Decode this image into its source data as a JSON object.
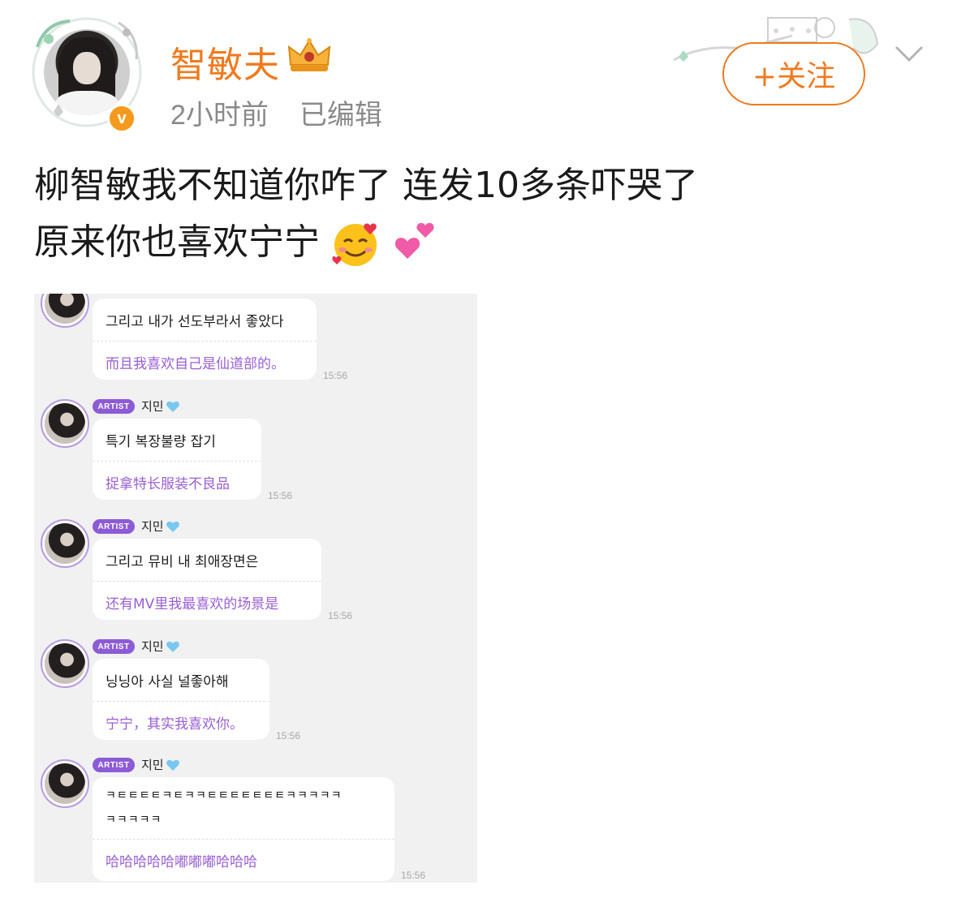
{
  "header": {
    "username": "智敏夫",
    "time_ago": "2小时前",
    "edited": "已编辑",
    "follow_label": "+关注",
    "verified_symbol": "v"
  },
  "post": {
    "line1": "柳智敏我不知道你咋了 连发10多条吓哭了",
    "line2": "原来你也喜欢宁宁"
  },
  "chat": {
    "messages": [
      {
        "sender": "",
        "badge": "",
        "ko": "그리고 내가 선도부라서 좋았다",
        "ko2": "",
        "zh": "而且我喜欢自己是仙道部的。",
        "time": "15:56"
      },
      {
        "sender": "지민",
        "badge": "ARTIST",
        "ko": "특기 복장불량 잡기",
        "ko2": "",
        "zh": "捉拿特长服装不良品",
        "time": "15:56"
      },
      {
        "sender": "지민",
        "badge": "ARTIST",
        "ko": "그리고 뮤비 내 최애장면은",
        "ko2": "",
        "zh": "还有MV里我最喜欢的场景是",
        "time": "15:56"
      },
      {
        "sender": "지민",
        "badge": "ARTIST",
        "ko": "닝닝아 사실 널좋아해",
        "ko2": "",
        "zh": "宁宁，其实我喜欢你。",
        "time": "15:56"
      },
      {
        "sender": "지민",
        "badge": "ARTIST",
        "ko": "ㅋㅌㅌㅌㅌㅋㅌㅋㅋㅌㅌㅌㅌㅌㅌㅌㅋㅋㅋㅋㅋ",
        "ko2": "ㅋㅋㅋㅋㅋ",
        "zh": "哈哈哈哈哈嘟嘟嘟哈哈哈",
        "time": "15:56"
      }
    ]
  },
  "colors": {
    "brand_orange": "#f07a1e",
    "meta_gray": "#8a8a8a",
    "translation_purple": "#9a5fd6",
    "artist_badge": "#8c5bd6"
  },
  "icons": [
    "avatar-frame-icon",
    "verified-icon",
    "crown-icon",
    "chevron-down-icon",
    "smiling-face-with-hearts-emoji",
    "two-hearts-emoji",
    "blue-heart-icon"
  ]
}
